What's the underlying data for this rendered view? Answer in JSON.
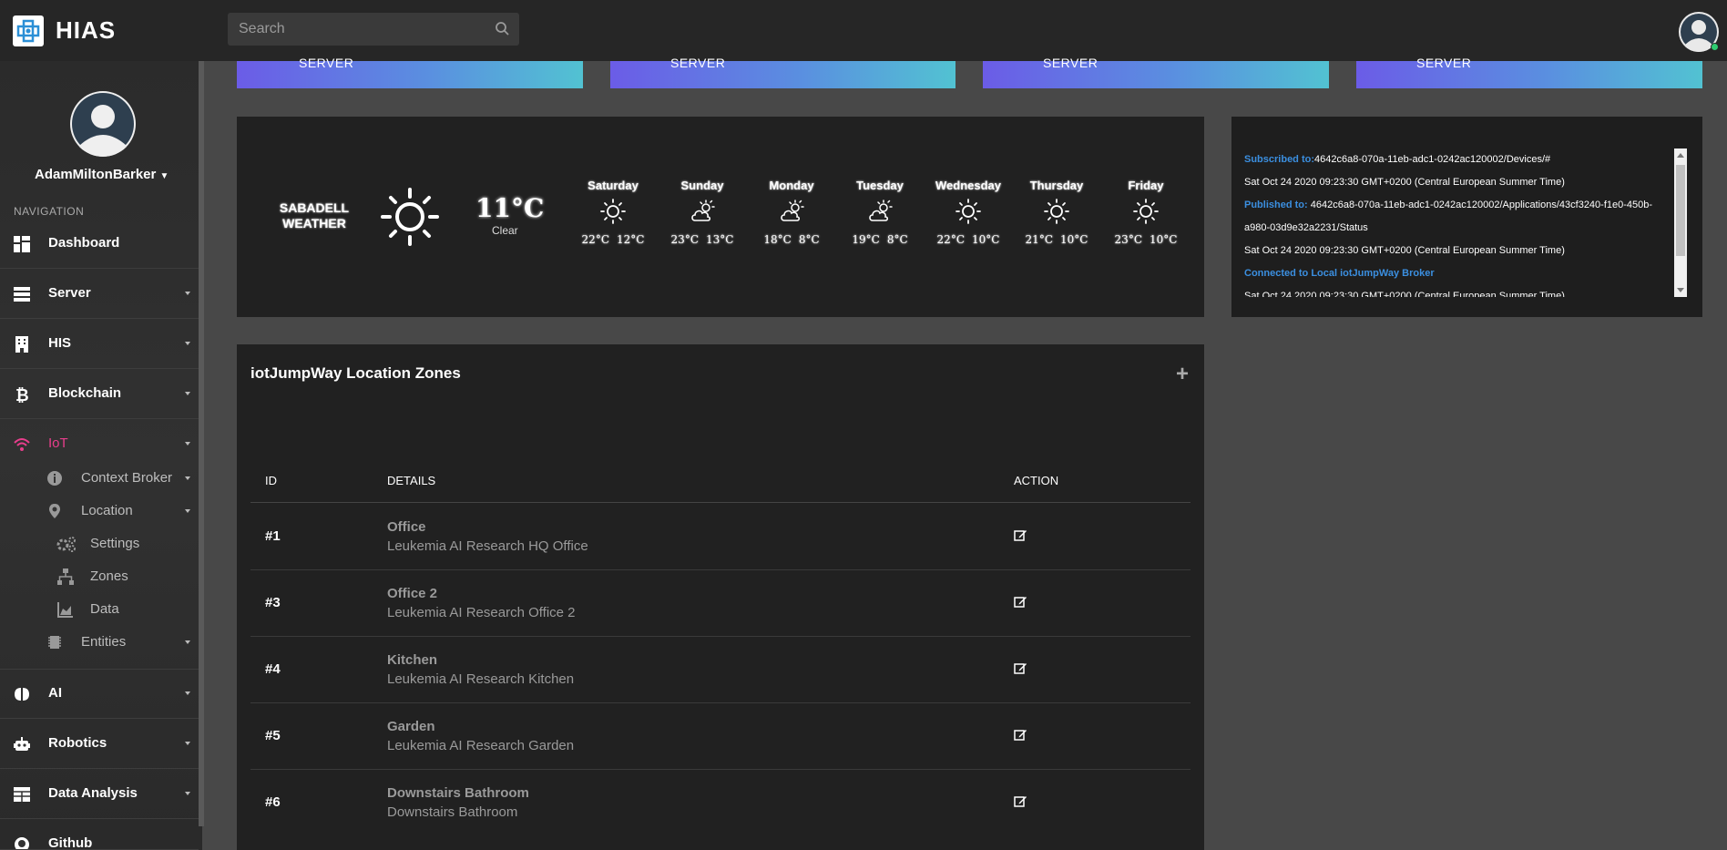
{
  "header": {
    "brand": "HIAS",
    "search_placeholder": "Search",
    "icons": [
      "hias-logo-icon",
      "search-icon",
      "user-avatar-icon"
    ],
    "status_color": "#2ecc71"
  },
  "sidebar": {
    "profile_name": "AdamMiltonBarker",
    "nav_title": "NAVIGATION",
    "items": [
      {
        "label": "Dashboard",
        "icon": "dashboard-icon"
      },
      {
        "label": "Server",
        "icon": "server-icon"
      },
      {
        "label": "HIS",
        "icon": "hospital-icon"
      },
      {
        "label": "Blockchain",
        "icon": "bitcoin-icon"
      },
      {
        "label": "IoT",
        "icon": "wifi-icon",
        "active": true
      },
      {
        "label": "AI",
        "icon": "brain-icon"
      },
      {
        "label": "Robotics",
        "icon": "robot-icon"
      },
      {
        "label": "Data Analysis",
        "icon": "table-icon"
      },
      {
        "label": "Github",
        "icon": "github-icon"
      }
    ],
    "iot_sub": [
      {
        "label": "Context Broker",
        "icon": "info-icon"
      },
      {
        "label": "Location",
        "icon": "map-pin-icon"
      },
      {
        "label": "Settings",
        "icon": "cogs-icon"
      },
      {
        "label": "Zones",
        "icon": "sitemap-icon"
      },
      {
        "label": "Data",
        "icon": "area-chart-icon"
      },
      {
        "label": "Entities",
        "icon": "chip-icon"
      }
    ],
    "active_color": "#e83e8c"
  },
  "server_cards": [
    "SERVER",
    "SERVER",
    "SERVER",
    "SERVER"
  ],
  "weather": {
    "city_line1": "SABADELL",
    "city_line2": "WEATHER",
    "temp": "11°C",
    "condition": "Clear",
    "icon": "sun-icon",
    "days": [
      {
        "name": "Saturday",
        "high": "22°C",
        "low": "12°C",
        "icon": "sun-icon"
      },
      {
        "name": "Sunday",
        "high": "23°C",
        "low": "13°C",
        "icon": "cloud-sun-icon"
      },
      {
        "name": "Monday",
        "high": "18°C",
        "low": "8°C",
        "icon": "cloud-sun-icon"
      },
      {
        "name": "Tuesday",
        "high": "19°C",
        "low": "8°C",
        "icon": "cloud-sun-icon"
      },
      {
        "name": "Wednesday",
        "high": "22°C",
        "low": "10°C",
        "icon": "sun-icon"
      },
      {
        "name": "Thursday",
        "high": "21°C",
        "low": "10°C",
        "icon": "sun-icon"
      },
      {
        "name": "Friday",
        "high": "23°C",
        "low": "10°C",
        "icon": "sun-icon"
      }
    ]
  },
  "console": {
    "subscribed_label": "Subscribed to:",
    "subscribed_topic": "4642c6a8-070a-11eb-adc1-0242ac120002/Devices/#",
    "time1": "Sat Oct 24 2020 09:23:30 GMT+0200 (Central European Summer Time)",
    "published_label": "Published to:",
    "published_topic_1": "4642c6a8-070a-11eb-adc1-0242ac120002/Applications/43cf3240-f1e0-450b-",
    "published_topic_2": "a980-03d9e32a2231/Status",
    "time2": "Sat Oct 24 2020 09:23:30 GMT+0200 (Central European Summer Time)",
    "connected": "Connected to Local iotJumpWay Broker",
    "time3": "Sat Oct 24 2020 09:23:30 GMT+0200 (Central European Summer Time)"
  },
  "zones": {
    "title": "iotJumpWay Location Zones",
    "add_icon": "plus-icon",
    "columns": [
      "ID",
      "DETAILS",
      "ACTION"
    ],
    "rows": [
      {
        "id": "#1",
        "name": "Office",
        "desc": "Leukemia AI Research HQ Office"
      },
      {
        "id": "#3",
        "name": "Office 2",
        "desc": "Leukemia AI Research Office 2"
      },
      {
        "id": "#4",
        "name": "Kitchen",
        "desc": "Leukemia AI Research Kitchen"
      },
      {
        "id": "#5",
        "name": "Garden",
        "desc": "Leukemia AI Research Garden"
      },
      {
        "id": "#6",
        "name": "Downstairs Bathroom",
        "desc": "Downstairs Bathroom"
      }
    ],
    "edit_icon": "edit-icon"
  }
}
